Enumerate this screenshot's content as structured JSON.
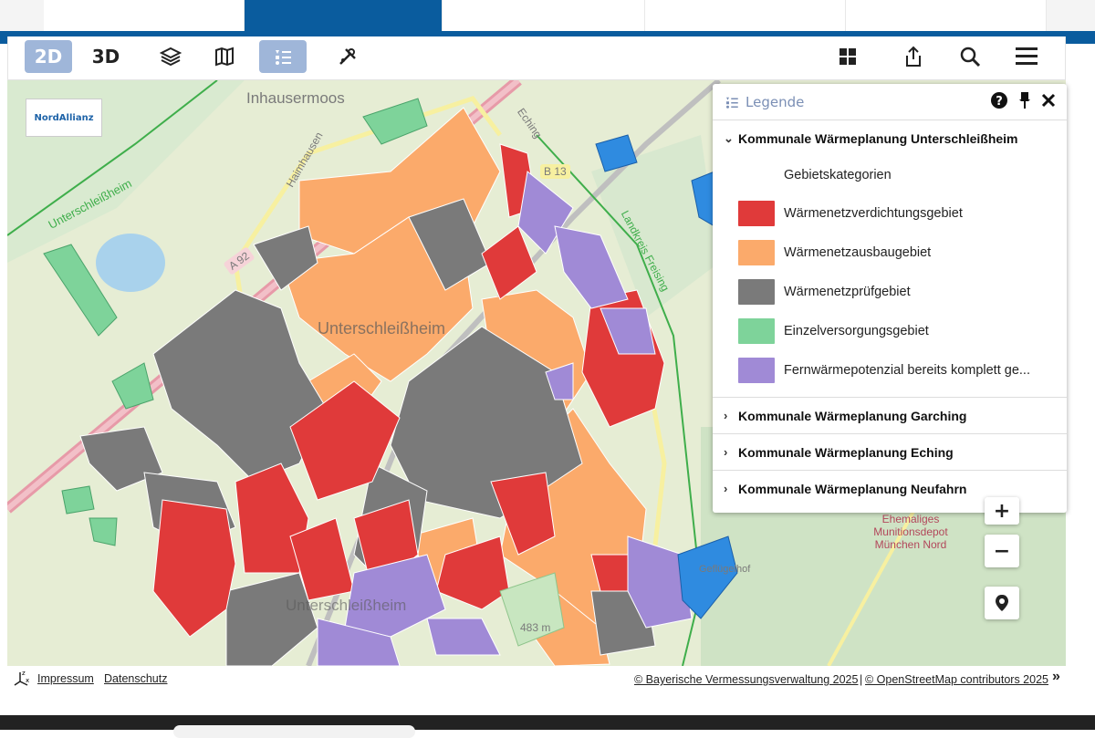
{
  "toolbar": {
    "btn_2d": "2D",
    "btn_3d": "3D"
  },
  "map": {
    "logo_text": "NordAllianz",
    "labels": {
      "inhausermoos": "Inhausermoos",
      "unterschleissheim_nw": "Unterschleißheim",
      "haimhausen": "Haimhausen",
      "a92": "A 92",
      "eching": "Eching",
      "b13": "B 13",
      "landkreis": "Landkreis Freising",
      "unterschleissheim_center": "Unterschleißheim",
      "unterschleissheim_south": "Unterschleißheim",
      "munitionsdepot": "Ehemaliges Munitionsdepot München Nord",
      "gefluegelhof": "Geflügelhof",
      "elevation": "483 m"
    }
  },
  "legend": {
    "title": "Legende",
    "group_1": "Kommunale Wärmeplanung Unterschleißheim",
    "subheading": "Gebietskategorien",
    "items": [
      {
        "label": "Wärmenetzverdichtungsgebiet",
        "color": "#e03a3a"
      },
      {
        "label": "Wärmenetzausbaugebiet",
        "color": "#fbaa6b"
      },
      {
        "label": "Wärmenetzprüfgebiet",
        "color": "#7a7a7a"
      },
      {
        "label": "Einzelversorgungsgebiet",
        "color": "#7ed39a"
      },
      {
        "label": "Fernwärmepotenzial bereits komplett ge...",
        "color": "#a08ad6"
      }
    ],
    "group_2": "Kommunale Wärmeplanung Garching",
    "group_3": "Kommunale Wärmeplanung Eching",
    "group_4": "Kommunale Wärmeplanung Neufahrn"
  },
  "controls": {
    "zoom_in": "+",
    "zoom_out": "−"
  },
  "footer": {
    "impressum": "Impressum",
    "datenschutz": "Datenschutz",
    "attribution_1": "© Bayerische Vermessungsverwaltung 2025",
    "separator": "|",
    "attribution_2": "© OpenStreetMap contributors 2025",
    "expand": "»"
  },
  "colors": {
    "brand_blue": "#0a5c9e",
    "red": "#e03a3a",
    "orange": "#fbaa6b",
    "grey": "#7a7a7a",
    "green": "#7ed39a",
    "purple": "#a08ad6"
  }
}
